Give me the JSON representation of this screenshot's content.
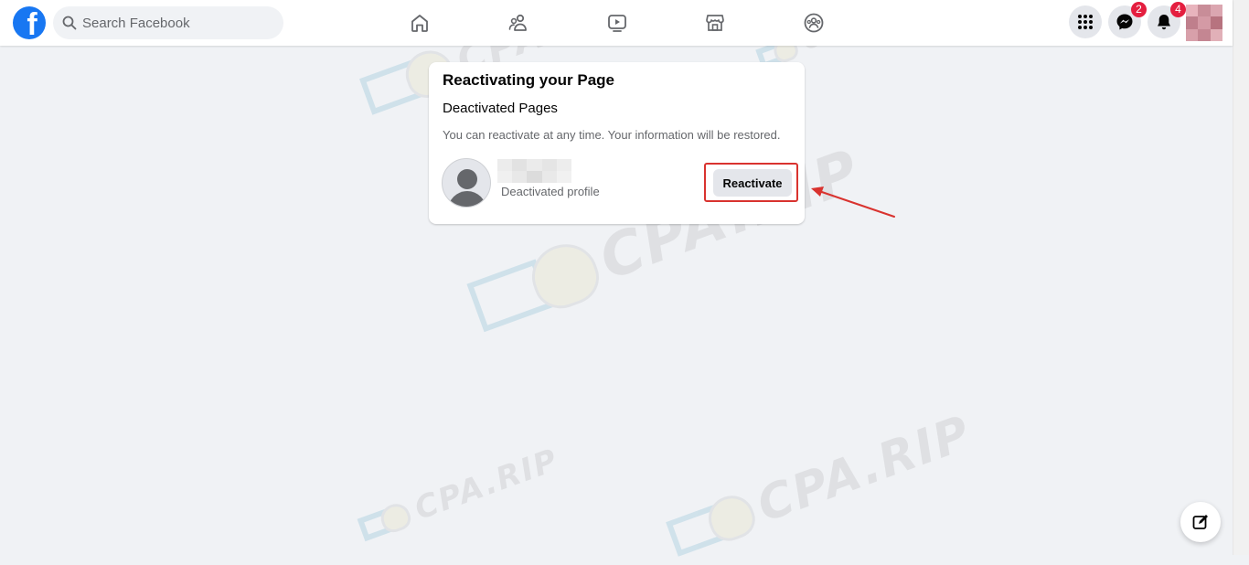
{
  "topbar": {
    "logo_letter": "f",
    "search_placeholder": "Search Facebook",
    "nav_icons": [
      "home-icon",
      "friends-icon",
      "watch-icon",
      "marketplace-icon",
      "groups-icon"
    ],
    "messenger_badge": "2",
    "notifications_badge": "4"
  },
  "card": {
    "title": "Reactivating your Page",
    "subtitle": "Deactivated Pages",
    "description": "You can reactivate at any time. Your information will be restored.",
    "page_status": "Deactivated profile",
    "reactivate_label": "Reactivate"
  },
  "watermark_text": "CPA.RIP",
  "colors": {
    "brand": "#1877f2",
    "background": "#f0f2f5",
    "badge": "#e41e3f",
    "highlight": "#d9332f"
  }
}
